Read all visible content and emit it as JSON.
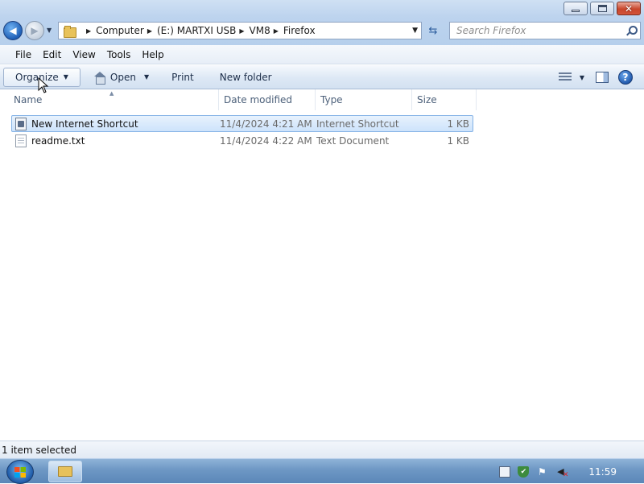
{
  "window": {
    "controls": {
      "minimize": "minimize",
      "maximize": "maximize",
      "close": "close"
    }
  },
  "navigation": {
    "breadcrumbs": [
      "Computer",
      "(E:) MARTXI USB",
      "VM8",
      "Firefox"
    ]
  },
  "search": {
    "placeholder": "Search Firefox"
  },
  "menu": {
    "items": [
      "File",
      "Edit",
      "View",
      "Tools",
      "Help"
    ]
  },
  "toolbar": {
    "organize_label": "Organize",
    "open_label": "Open",
    "print_label": "Print",
    "new_folder_label": "New folder"
  },
  "list": {
    "columns": [
      "Name",
      "Date modified",
      "Type",
      "Size"
    ],
    "files": [
      {
        "name": "New Internet Shortcut",
        "date": "11/4/2024 4:21 AM",
        "type": "Internet Shortcut",
        "size": "1 KB",
        "icon": "shortcut-icon",
        "selected": true
      },
      {
        "name": "readme.txt",
        "date": "11/4/2024 4:22 AM",
        "type": "Text Document",
        "size": "1 KB",
        "icon": "text-file-icon",
        "selected": false
      }
    ]
  },
  "status": {
    "text": "1 item selected"
  },
  "taskbar": {
    "clock": "11:59"
  },
  "colors": {
    "selection": "#cde3fb",
    "taskbar": "#6d97c4",
    "chrome": "#bcd3ee"
  }
}
